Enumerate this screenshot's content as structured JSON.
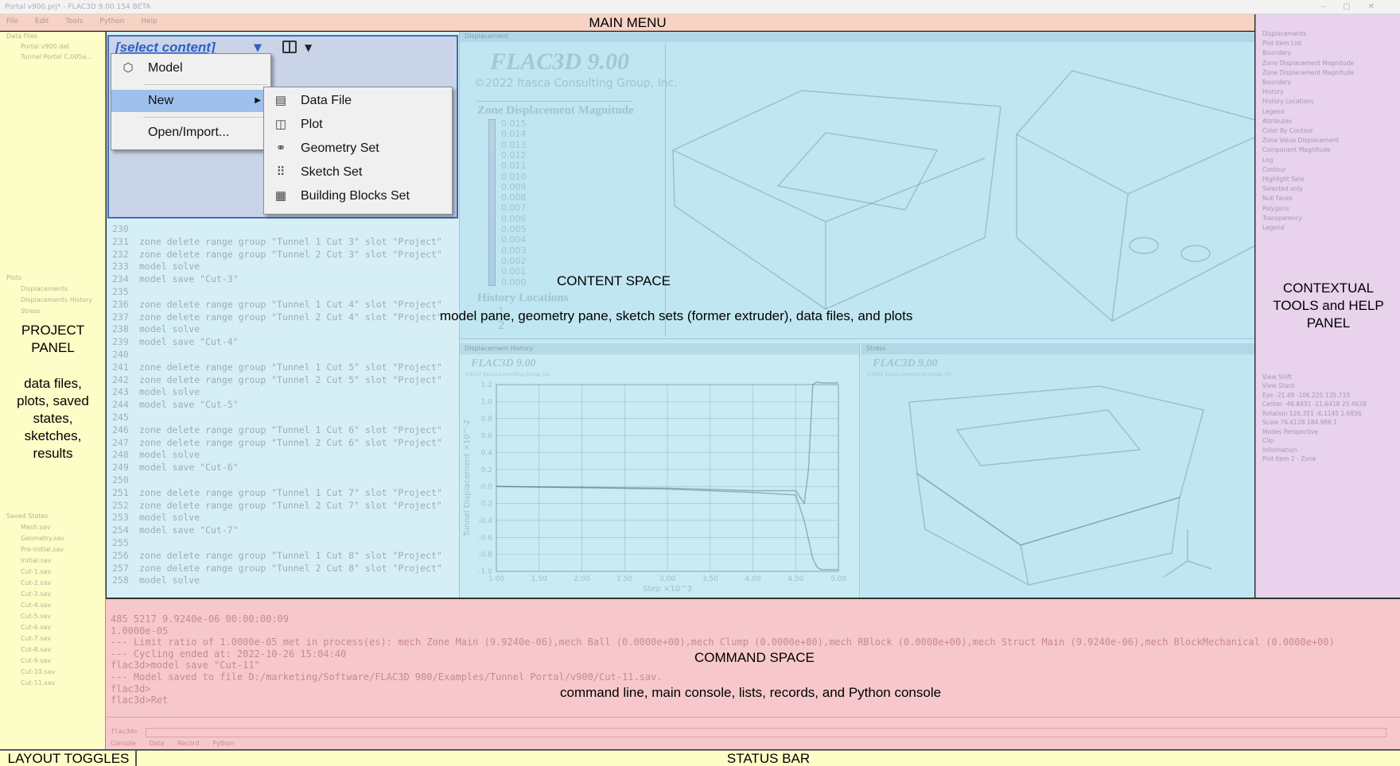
{
  "window": {
    "title": "Portal v900.prj* - FLAC3D 9.00.154 BETA",
    "controls": [
      "–",
      "▢",
      "✕"
    ]
  },
  "menu_bar": {
    "items": [
      "File",
      "Edit",
      "Tools",
      "Python",
      "Help"
    ]
  },
  "regions": {
    "main_menu": "MAIN MENU",
    "project_panel_title": "PROJECT PANEL",
    "project_panel_desc": "data files, plots, saved states, sketches, results",
    "content_title": "CONTENT SPACE",
    "content_desc": "model pane, geometry pane, sketch sets (former extruder), data files, and plots",
    "tools_title": "CONTEXTUAL TOOLS and HELP PANEL",
    "command_title": "COMMAND SPACE",
    "command_desc": "command line, main console, lists, records, and Python console",
    "layout_toggles": "LAYOUT TOGGLES",
    "status_bar": "STATUS BAR"
  },
  "select_content": {
    "trigger": "[select content]",
    "menu": {
      "model": "Model",
      "new": "New",
      "open_import": "Open/Import..."
    },
    "submenu": [
      "Data File",
      "Plot",
      "Geometry Set",
      "Sketch Set",
      "Building Blocks Set"
    ]
  },
  "project_tree": {
    "data_files_header": "Data Files",
    "data_files": [
      "Portal v900.dat",
      "Tunnel Portal C.005a..."
    ],
    "plots_header": "Plots",
    "plots": [
      "Displacements",
      "Displacements History",
      "Stress"
    ],
    "saved_states_header": "Saved States",
    "saved_states": [
      "Mesh.sav",
      "Geometry.sav",
      "Pre-Initial.sav",
      "Initial.sav",
      "Cut-1.sav",
      "Cut-2.sav",
      "Cut-3.sav",
      "Cut-4.sav",
      "Cut-5.sav",
      "Cut-6.sav",
      "Cut-7.sav",
      "Cut-8.sav",
      "Cut-9.sav",
      "Cut-10.sav",
      "Cut-11.sav"
    ]
  },
  "editor_lines": [
    {
      "n": "230",
      "t": ""
    },
    {
      "n": "231",
      "t": "zone delete range group \"Tunnel 1 Cut 3\" slot \"Project\""
    },
    {
      "n": "232",
      "t": "zone delete range group \"Tunnel 2 Cut 3\" slot \"Project\""
    },
    {
      "n": "233",
      "t": "model solve"
    },
    {
      "n": "234",
      "t": "model save \"Cut-3\""
    },
    {
      "n": "235",
      "t": ""
    },
    {
      "n": "236",
      "t": "zone delete range group \"Tunnel 1 Cut 4\" slot \"Project\""
    },
    {
      "n": "237",
      "t": "zone delete range group \"Tunnel 2 Cut 4\" slot \"Project\""
    },
    {
      "n": "238",
      "t": "model solve"
    },
    {
      "n": "239",
      "t": "model save \"Cut-4\""
    },
    {
      "n": "240",
      "t": ""
    },
    {
      "n": "241",
      "t": "zone delete range group \"Tunnel 1 Cut 5\" slot \"Project\""
    },
    {
      "n": "242",
      "t": "zone delete range group \"Tunnel 2 Cut 5\" slot \"Project\""
    },
    {
      "n": "243",
      "t": "model solve"
    },
    {
      "n": "244",
      "t": "model save \"Cut-5\""
    },
    {
      "n": "245",
      "t": ""
    },
    {
      "n": "246",
      "t": "zone delete range group \"Tunnel 1 Cut 6\" slot \"Project\""
    },
    {
      "n": "247",
      "t": "zone delete range group \"Tunnel 2 Cut 6\" slot \"Project\""
    },
    {
      "n": "248",
      "t": "model solve"
    },
    {
      "n": "249",
      "t": "model save \"Cut-6\""
    },
    {
      "n": "250",
      "t": ""
    },
    {
      "n": "251",
      "t": "zone delete range group \"Tunnel 1 Cut 7\" slot \"Project\""
    },
    {
      "n": "252",
      "t": "zone delete range group \"Tunnel 2 Cut 7\" slot \"Project\""
    },
    {
      "n": "253",
      "t": "model solve"
    },
    {
      "n": "254",
      "t": "model save \"Cut-7\""
    },
    {
      "n": "255",
      "t": ""
    },
    {
      "n": "256",
      "t": "zone delete range group \"Tunnel 1 Cut 8\" slot \"Project\""
    },
    {
      "n": "257",
      "t": "zone delete range group \"Tunnel 2 Cut 8\" slot \"Project\""
    },
    {
      "n": "258",
      "t": "model solve"
    }
  ],
  "model_pane": {
    "tab": "Displacement",
    "brand": "FLAC3D 9.00",
    "copyright": "©2022 Itasca Consulting Group, Inc.",
    "legend_title": "Zone Displacement Magnitude",
    "legend_values": [
      "0.015",
      "0.014",
      "0.013",
      "0.012",
      "0.011",
      "0.010",
      "0.009",
      "0.008",
      "0.007",
      "0.006",
      "0.005",
      "0.004",
      "0.003",
      "0.002",
      "0.001",
      "0.000"
    ],
    "history_title": "History Locations",
    "history_items": [
      "1",
      "2"
    ]
  },
  "plot_pane": {
    "tab": "Displacement History",
    "brand": "FLAC3D 9.00",
    "copyright": "©2022 Itasca Consulting Group, Inc.",
    "ylabel": "Tunnel Displacement ×10^-2",
    "xlabel": "Step ×10^3"
  },
  "geom_pane": {
    "tab": "Stress",
    "brand": "FLAC3D 9.00",
    "copyright": "©2022 Itasca Consulting Group, Inc."
  },
  "chart_data": {
    "type": "line",
    "title": "",
    "xlabel": "Step ×10^3",
    "ylabel": "Tunnel Displacement ×10^-2",
    "xlim": [
      1.0,
      5.0
    ],
    "ylim": [
      -1.0,
      1.2
    ],
    "x_ticks": [
      "1.00",
      "1.50",
      "2.00",
      "2.50",
      "3.00",
      "3.50",
      "4.00",
      "4.50",
      "5.00"
    ],
    "y_ticks": [
      "1.2",
      "1.0",
      "0.8",
      "0.6",
      "0.4",
      "0.2",
      "0.0",
      "-0.2",
      "-0.4",
      "-0.6",
      "-0.8",
      "-1.0"
    ],
    "grid": true,
    "series": [
      {
        "x": [
          1.0,
          3.0,
          4.0,
          4.5,
          4.6,
          4.65,
          4.7,
          4.75,
          4.8,
          5.0
        ],
        "values": [
          0.0,
          -0.02,
          -0.05,
          -0.05,
          -0.2,
          0.2,
          1.2,
          1.23,
          1.22,
          1.22
        ]
      },
      {
        "x": [
          1.0,
          3.0,
          4.0,
          4.5,
          4.6,
          4.7,
          4.75,
          4.8,
          5.0
        ],
        "values": [
          0.0,
          -0.03,
          -0.07,
          -0.1,
          -0.4,
          -0.85,
          -0.95,
          -0.98,
          -0.98
        ]
      }
    ]
  },
  "tools_panel": {
    "lines": [
      "Displacements",
      "Plot Item List",
      "Boundary",
      "Zone Displacement Magnitude",
      "Zone Displacement Magnitude",
      "Boundary",
      "History",
      "History Locations",
      "Legend",
      "Attributes",
      "Color By   Contour",
      "Zone Value   Displacement",
      "Component   Magnitude",
      "Log",
      "Contour",
      "Highlight Sele",
      "Selected only",
      "Null Faces",
      "Polygons",
      "Transparency",
      "Legend",
      "View Shift",
      "View Stack",
      "Eye   -21.49   -106.225   135.733",
      "Center   -46.8431   -11.6418   25.4638",
      "Rotation   126.351   -6.1145   1.6836",
      "Scale   76.6128   184.986   1",
      "Modes   Perspective",
      "Clip",
      "Information",
      "Plot Item 2 - Zone"
    ]
  },
  "console": {
    "lines": [
      "     485       5217 9.9240e-06 00:00:00:09",
      "                    1.0000e-05",
      "--- Limit ratio of 1.0000e-05 met in process(es): mech Zone Main (9.9240e-06),mech Ball (0.0000e+00),mech Clump (0.0000e+00),mech RBlock (0.0000e+00),mech Struct Main (9.9240e-06),mech BlockMechanical (0.0000e+00)",
      "--- Cycling ended at: 2022-10-26 15:04:40",
      "flac3d>model save \"Cut-11\"",
      "--- Model saved to file D:/marketing/Software/FLAC3D 900/Examples/Tunnel Portal/v900/Cut-11.sav.",
      "flac3d>",
      "flac3d>Ret"
    ],
    "prompt": "flac3d>",
    "tabs": [
      "Console",
      "Data Record",
      "Python"
    ]
  }
}
